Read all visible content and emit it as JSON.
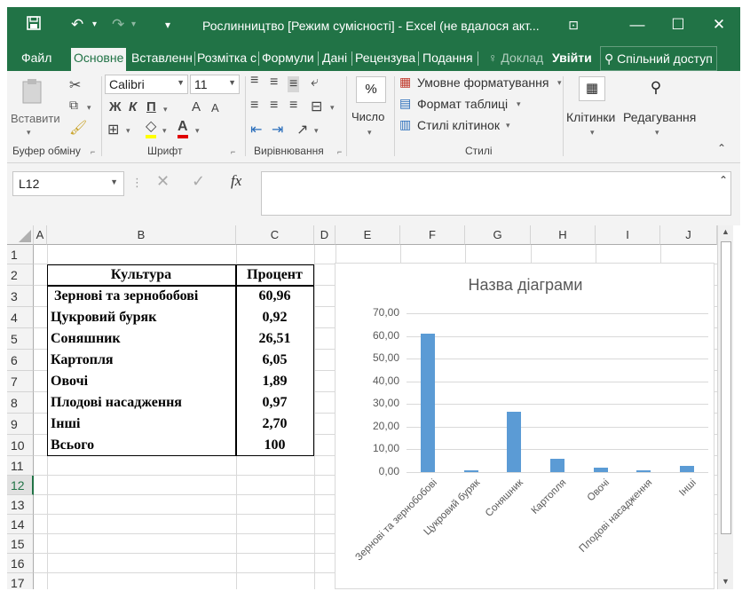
{
  "titlebar": {
    "title": "Рослинництво  [Режим сумісності] - Excel (не вдалося акт...",
    "save_icon": "save-icon",
    "undo_icon": "undo-icon",
    "redo_icon": "redo-icon"
  },
  "tabs": [
    {
      "label": "Файл"
    },
    {
      "label": "Основне"
    },
    {
      "label": "Вставленн"
    },
    {
      "label": "Розмітка с"
    },
    {
      "label": "Формули"
    },
    {
      "label": "Дані"
    },
    {
      "label": "Рецензува"
    },
    {
      "label": "Подання"
    },
    {
      "label": "Доклад"
    },
    {
      "label": "Увійти"
    },
    {
      "label": "Спільний доступ"
    }
  ],
  "ribbon": {
    "paste_label": "Вставити",
    "font_name": "Calibri",
    "font_size": "11",
    "bold": "Ж",
    "italic": "К",
    "underline": "П",
    "grow_font": "A",
    "shrink_font": "A",
    "number_label": "Число",
    "percent": "%",
    "conditional_format": "Умовне форматування",
    "format_table": "Формат таблиці",
    "cell_styles": "Стилі клітинок",
    "cells_label": "Клітинки",
    "editing_label": "Редагування",
    "groups": {
      "clipboard": "Буфер обміну",
      "font": "Шрифт",
      "alignment": "Вирівнювання",
      "styles": "Стилі"
    }
  },
  "formula_bar": {
    "name_box": "L12",
    "fx": "fx",
    "formula": ""
  },
  "columns": [
    "A",
    "B",
    "C",
    "D",
    "E",
    "F",
    "G",
    "H",
    "I",
    "J"
  ],
  "rows": [
    "1",
    "2",
    "3",
    "4",
    "5",
    "6",
    "7",
    "8",
    "9",
    "10",
    "11",
    "12",
    "13",
    "14",
    "15",
    "16",
    "17"
  ],
  "selected_row": "12",
  "table": {
    "header": {
      "culture": "Культура",
      "percent": "Процент"
    },
    "rows": [
      {
        "culture": "Зернові та зернобобові",
        "percent": "60,96"
      },
      {
        "culture": "Цукровий буряк",
        "percent": "0,92"
      },
      {
        "culture": "Соняшник",
        "percent": "26,51"
      },
      {
        "culture": "Картопля",
        "percent": "6,05"
      },
      {
        "culture": "Овочі",
        "percent": "1,89"
      },
      {
        "culture": "Плодові насадження",
        "percent": "0,97"
      },
      {
        "culture": "Інші",
        "percent": "2,70"
      },
      {
        "culture": "Всього",
        "percent": "100"
      }
    ]
  },
  "chart_data": {
    "type": "bar",
    "title": "Назва діаграми",
    "categories": [
      "Зернові та зернобобові",
      "Цукровий буряк",
      "Соняшник",
      "Картопля",
      "Овочі",
      "Плодові насадження",
      "Інші"
    ],
    "values": [
      60.96,
      0.92,
      26.51,
      6.05,
      1.89,
      0.97,
      2.7
    ],
    "ylim": [
      0,
      70
    ],
    "yticks": [
      "0,00",
      "10,00",
      "20,00",
      "30,00",
      "40,00",
      "50,00",
      "60,00",
      "70,00"
    ],
    "grid": true,
    "color": "#5b9bd5"
  },
  "colors": {
    "brand": "#217346",
    "bar": "#5b9bd5"
  }
}
